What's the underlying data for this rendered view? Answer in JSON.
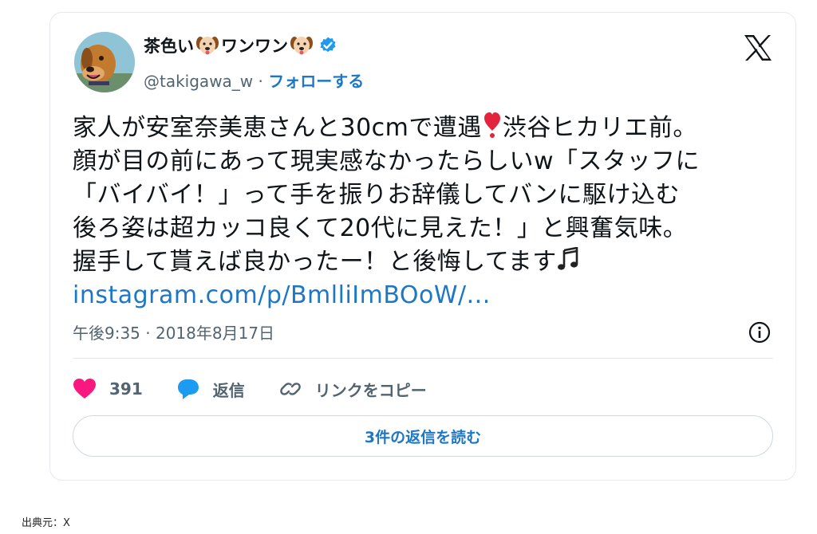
{
  "user": {
    "name_prefix": "茶色い",
    "name_middle": "ワンワン",
    "handle": "@takigawa_w",
    "separator": " · ",
    "follow_label": "フォローする"
  },
  "tweet": {
    "lines": [
      "家人が安室奈美恵さんと30cmで遭遇",
      "渋谷ヒカリエ前。",
      "顔が目の前にあって現実感なかったらしいw「スタッフに",
      "「バイバイ！」って手を振りお辞儀してバンに駆け込む",
      "後ろ姿は超カッコ良くて20代に見えた！」と興奮気味。",
      "握手して貰えば良かったー！と後悔してます"
    ],
    "link": "instagram.com/p/BmlliImBOoW/...",
    "timestamp": "午後9:35 · 2018年8月17日"
  },
  "actions": {
    "like_count": "391",
    "reply_label": "返信",
    "copy_link_label": "リンクをコピー"
  },
  "read_replies_label": "3件の返信を読む",
  "source_caption": "出典元：X",
  "colors": {
    "link_blue": "#1d77c5",
    "like_pink": "#f91880",
    "reply_blue": "#1d9bf0",
    "verified_blue": "#1d9bf0",
    "secondary_text": "#536471"
  },
  "icons": {
    "avatar": "dog-avatar",
    "name_emoji": "dog-face-icon",
    "verified": "verified-badge-icon",
    "logo": "x-logo-icon",
    "heart_emoji": "red-exclamation-heart-icon",
    "note_emoji": "music-notes-icon",
    "info": "info-icon",
    "like": "heart-icon",
    "reply": "speech-bubble-icon",
    "copy": "link-icon"
  }
}
